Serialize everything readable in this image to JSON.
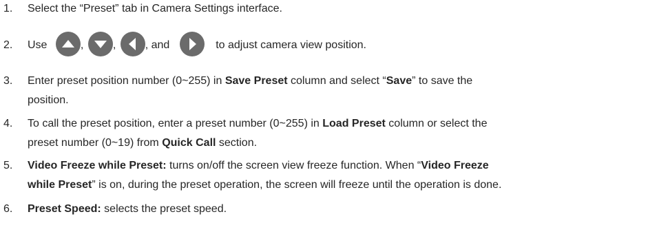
{
  "steps": [
    {
      "num": "1.",
      "parts": [
        "Select the “Preset” tab in Camera Settings interface."
      ]
    },
    {
      "num": "2.",
      "use_label": "Use",
      "comma_1": ",",
      "comma_2": ",",
      "and_label": ", and",
      "tail": "to adjust camera view position.",
      "icons": [
        "up-arrow-icon",
        "down-arrow-icon",
        "left-arrow-icon",
        "right-arrow-icon"
      ]
    },
    {
      "num": "3.",
      "line1_a": "Enter preset position number (0~255) in ",
      "line1_b": "Save Preset",
      "line1_c": " column and select “",
      "line1_d": "Save",
      "line1_e": "” to save the",
      "line2": "position."
    },
    {
      "num": "4.",
      "line1_a": "To call the preset position, enter a preset number (0~255) in ",
      "line1_b": "Load Preset",
      "line1_c": " column or select the",
      "line2_a": "preset number (0~19) from ",
      "line2_b": "Quick Call",
      "line2_c": " section."
    },
    {
      "num": "5.",
      "line1_a": "Video Freeze while Preset:",
      "line1_b": " turns on/off the screen view freeze function. When “",
      "line1_c": "Video Freeze",
      "line2_a": "while Preset",
      "line2_b": "” is on, during the preset operation, the screen will freeze until the operation is done."
    },
    {
      "num": "6.",
      "line1_a": "Preset Speed:",
      "line1_b": " selects the preset speed."
    }
  ],
  "colors": {
    "text": "#262626",
    "icon_bg": "#6b6b6b",
    "icon_fg": "#ffffff"
  }
}
